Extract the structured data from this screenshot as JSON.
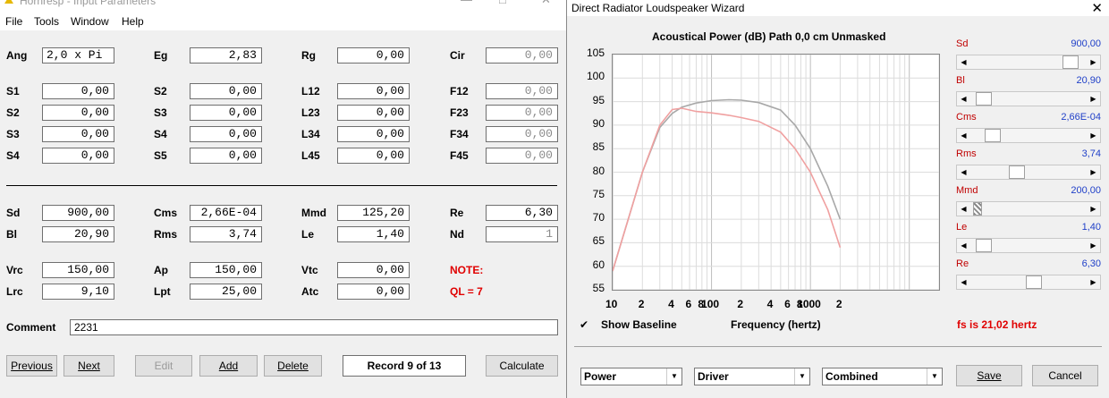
{
  "left_window": {
    "title": "Hornresp - Input Parameters",
    "menu": [
      "File",
      "Tools",
      "Window",
      "Help"
    ],
    "rows1": [
      {
        "l1": "Ang",
        "v1": "2,0 x Pi",
        "l2": "Eg",
        "v2": "2,83",
        "l3": "Rg",
        "v3": "0,00",
        "l4": "Cir",
        "v4": "0,00"
      }
    ],
    "rows2": [
      {
        "l1": "S1",
        "v1": "0,00",
        "l2": "S2",
        "v2": "0,00",
        "l3": "L12",
        "v3": "0,00",
        "l4": "F12",
        "v4": "0,00"
      },
      {
        "l1": "S2",
        "v1": "0,00",
        "l2": "S3",
        "v2": "0,00",
        "l3": "L23",
        "v3": "0,00",
        "l4": "F23",
        "v4": "0,00"
      },
      {
        "l1": "S3",
        "v1": "0,00",
        "l2": "S4",
        "v2": "0,00",
        "l3": "L34",
        "v3": "0,00",
        "l4": "F34",
        "v4": "0,00"
      },
      {
        "l1": "S4",
        "v1": "0,00",
        "l2": "S5",
        "v2": "0,00",
        "l3": "L45",
        "v3": "0,00",
        "l4": "F45",
        "v4": "0,00"
      }
    ],
    "driver": [
      {
        "l1": "Sd",
        "v1": "900,00",
        "l2": "Cms",
        "v2": "2,66E-04",
        "l3": "Mmd",
        "v3": "125,20",
        "l4": "Re",
        "v4": "6,30"
      },
      {
        "l1": "Bl",
        "v1": "20,90",
        "l2": "Rms",
        "v2": "3,74",
        "l3": "Le",
        "v3": "1,40",
        "l4": "Nd",
        "v4": "1"
      }
    ],
    "chamber": [
      {
        "l1": "Vrc",
        "v1": "150,00",
        "l2": "Ap",
        "v2": "150,00",
        "l3": "Vtc",
        "v3": "0,00",
        "l4": "NOTE:"
      },
      {
        "l1": "Lrc",
        "v1": "9,10",
        "l2": "Lpt",
        "v2": "25,00",
        "l3": "Atc",
        "v3": "0,00",
        "l4": "QL = 7"
      }
    ],
    "comment_label": "Comment",
    "comment_value": "2231",
    "buttons": {
      "previous": "Previous",
      "next": "Next",
      "edit": "Edit",
      "add": "Add",
      "delete": "Delete",
      "record": "Record 9 of 13",
      "calculate": "Calculate"
    }
  },
  "right_window": {
    "title": "Direct Radiator Loudspeaker Wizard",
    "chart_header": "Acoustical Power (dB)   Path 0,0 cm   Unmasked",
    "show_baseline": "Show Baseline",
    "xlabel": "Frequency (hertz)",
    "fs_text": "fs is 21,02 hertz",
    "params": [
      {
        "name": "Sd",
        "value": "900,00",
        "pos": 0.92
      },
      {
        "name": "Bl",
        "value": "20,90",
        "pos": 0.05
      },
      {
        "name": "Cms",
        "value": "2,66E-04",
        "pos": 0.14
      },
      {
        "name": "Rms",
        "value": "3,74",
        "pos": 0.38
      },
      {
        "name": "Mmd",
        "value": "200,00",
        "pos": 0.03
      },
      {
        "name": "Le",
        "value": "1,40",
        "pos": 0.05
      },
      {
        "name": "Re",
        "value": "6,30",
        "pos": 0.55
      }
    ],
    "combos": [
      "Power",
      "Driver",
      "Combined"
    ],
    "save": "Save",
    "cancel": "Cancel"
  },
  "chart_data": {
    "type": "line",
    "title": "Acoustical Power (dB)   Path 0,0 cm   Unmasked",
    "xlabel": "Frequency (hertz)",
    "ylabel": "",
    "x_scale": "log",
    "xlim": [
      10,
      20000
    ],
    "ylim": [
      55,
      105
    ],
    "yticks": [
      105,
      100,
      95,
      90,
      85,
      80,
      75,
      70,
      65,
      60,
      55
    ],
    "xtick_labels": [
      "10",
      "2",
      "4",
      "6",
      "8",
      "100",
      "2",
      "4",
      "6",
      "8",
      "1000",
      "2"
    ],
    "grid": true,
    "series": [
      {
        "color": "#a8a8a8",
        "x": [
          10,
          20,
          30,
          40,
          50,
          70,
          100,
          150,
          200,
          300,
          500,
          700,
          1000,
          1500,
          2000
        ],
        "y": [
          59,
          80,
          89.5,
          92.5,
          93.8,
          94.7,
          95.2,
          95.4,
          95.3,
          94.8,
          93.2,
          90,
          85,
          77,
          70
        ]
      },
      {
        "color": "#f0a0a0",
        "x": [
          10,
          20,
          30,
          40,
          50,
          70,
          100,
          150,
          200,
          300,
          500,
          700,
          1000,
          1500,
          2000
        ],
        "y": [
          59,
          80,
          90,
          93.3,
          93.6,
          92.9,
          92.6,
          92.1,
          91.6,
          90.8,
          88.5,
          85,
          80,
          72,
          64
        ]
      }
    ]
  }
}
